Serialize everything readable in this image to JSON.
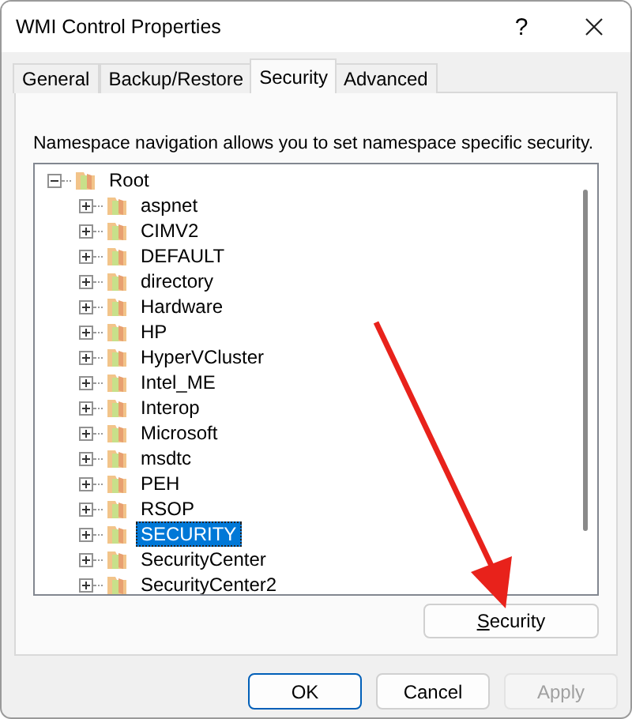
{
  "window": {
    "title": "WMI Control Properties",
    "help": "?"
  },
  "tabs": [
    {
      "label": "General",
      "selected": false
    },
    {
      "label": "Backup/Restore",
      "selected": false
    },
    {
      "label": "Security",
      "selected": true
    },
    {
      "label": "Advanced",
      "selected": false
    }
  ],
  "description": "Namespace navigation allows you to set namespace specific security.",
  "tree": {
    "label": "Root",
    "expanded": true,
    "selected": false,
    "children": [
      {
        "label": "aspnet",
        "expanded": false,
        "selected": false
      },
      {
        "label": "CIMV2",
        "expanded": false,
        "selected": false
      },
      {
        "label": "DEFAULT",
        "expanded": false,
        "selected": false
      },
      {
        "label": "directory",
        "expanded": false,
        "selected": false
      },
      {
        "label": "Hardware",
        "expanded": false,
        "selected": false
      },
      {
        "label": "HP",
        "expanded": false,
        "selected": false
      },
      {
        "label": "HyperVCluster",
        "expanded": false,
        "selected": false
      },
      {
        "label": "Intel_ME",
        "expanded": false,
        "selected": false
      },
      {
        "label": "Interop",
        "expanded": false,
        "selected": false
      },
      {
        "label": "Microsoft",
        "expanded": false,
        "selected": false
      },
      {
        "label": "msdtc",
        "expanded": false,
        "selected": false
      },
      {
        "label": "PEH",
        "expanded": false,
        "selected": false
      },
      {
        "label": "RSOP",
        "expanded": false,
        "selected": false
      },
      {
        "label": "SECURITY",
        "expanded": false,
        "selected": true
      },
      {
        "label": "SecurityCenter",
        "expanded": false,
        "selected": false
      },
      {
        "label": "SecurityCenter2",
        "expanded": false,
        "selected": false
      }
    ]
  },
  "security_button": {
    "label_parts": [
      {
        "text": "S",
        "underlined": true
      },
      {
        "text": "ecurity",
        "underlined": false
      }
    ]
  },
  "buttons": [
    {
      "label": "OK",
      "default": true,
      "disabled": false
    },
    {
      "label": "Cancel",
      "default": false,
      "disabled": false
    },
    {
      "label": "Apply",
      "default": false,
      "disabled": true
    }
  ]
}
